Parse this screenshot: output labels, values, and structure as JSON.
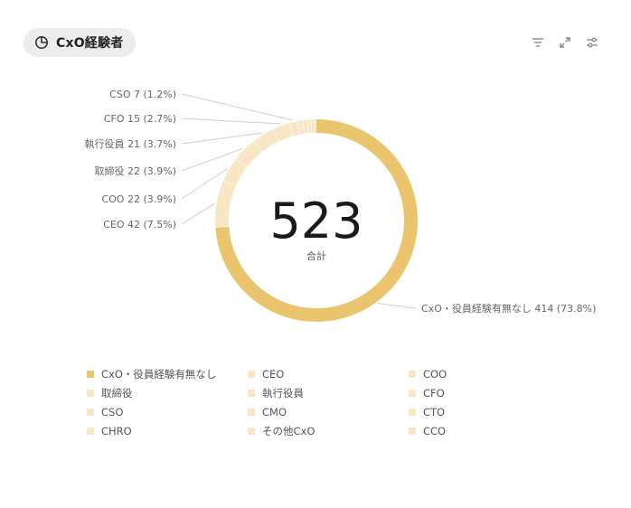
{
  "header": {
    "title": "CxO経験者"
  },
  "toolbar": {
    "filter_icon": "filter-icon",
    "expand_icon": "expand-icon",
    "settings_icon": "sliders-icon"
  },
  "colors": {
    "primary": "#ebc46e",
    "light": "#f8e6c4",
    "leader": "#cfcfcf",
    "text": "#666666"
  },
  "chart_data": {
    "type": "pie",
    "style": "donut",
    "center_value": "523",
    "center_label": "合計",
    "total": 523,
    "slices": [
      {
        "name": "CxO・役員経験有無なし",
        "value": 414,
        "label": "CxO・役員経験有無なし  414 (73.8%)"
      },
      {
        "name": "CEO",
        "value": 42,
        "label": "CEO  42 (7.5%)"
      },
      {
        "name": "COO",
        "value": 22,
        "label": "COO  22 (3.9%)"
      },
      {
        "name": "取締役",
        "value": 22,
        "label": "取締役  22 (3.9%)"
      },
      {
        "name": "執行役員",
        "value": 21,
        "label": "執行役員  21 (3.7%)"
      },
      {
        "name": "CFO",
        "value": 15,
        "label": "CFO  15 (2.7%)"
      },
      {
        "name": "CSO",
        "value": 7,
        "label": "CSO  7 (1.2%)"
      },
      {
        "name": "CMO",
        "value": 5
      },
      {
        "name": "CTO",
        "value": 4
      },
      {
        "name": "CHRO",
        "value": 3
      },
      {
        "name": "その他CxO",
        "value": 3
      },
      {
        "name": "CCO",
        "value": 2
      }
    ],
    "legend": [
      "CxO・役員経験有無なし",
      "CEO",
      "COO",
      "取締役",
      "執行役員",
      "CFO",
      "CSO",
      "CMO",
      "CTO",
      "CHRO",
      "その他CxO",
      "CCO"
    ],
    "legend_position": "bottom"
  }
}
